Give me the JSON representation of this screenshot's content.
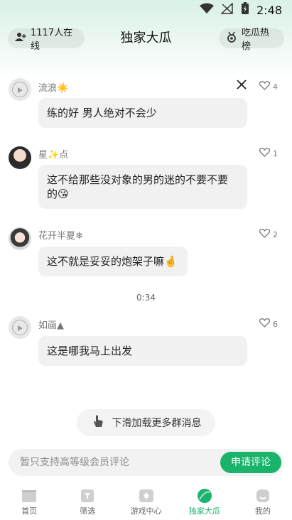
{
  "status": {
    "time": "2:48"
  },
  "header": {
    "online_label": "1117人在线",
    "title": "独家大瓜",
    "hot_label": "吃瓜热榜"
  },
  "messages": [
    {
      "nickname": "流浪☀️",
      "likes": "4",
      "text": "练的好 男人绝对不会少",
      "avatar": "default"
    },
    {
      "nickname": "星✨点",
      "likes": "1",
      "text_line1": "这不给那些没对象的男的迷的不要不要",
      "text_line2": "的😘",
      "avatar": "photo"
    },
    {
      "nickname": "花开半夏❄",
      "likes": "2",
      "text": "这不就是妥妥的炮架子嘛🤞",
      "avatar": "photo"
    },
    {
      "nickname": "如画▲",
      "likes": "6",
      "text": "这是哪我马上出发",
      "avatar": "default"
    }
  ],
  "time_separator": "0:34",
  "load_more_label": "下滑加载更多群消息",
  "comment": {
    "placeholder": "暂只支持高等级会员评论",
    "apply_label": "申请评论"
  },
  "tabs": [
    {
      "label": "首页",
      "icon": "clapper-icon"
    },
    {
      "label": "筛选",
      "icon": "filter-icon"
    },
    {
      "label": "游戏中心",
      "icon": "game-icon"
    },
    {
      "label": "独家大瓜",
      "icon": "melon-icon",
      "active": true
    },
    {
      "label": "我的",
      "icon": "profile-icon"
    }
  ],
  "colors": {
    "accent": "#19b36b",
    "bubble": "#f1f1f1"
  }
}
